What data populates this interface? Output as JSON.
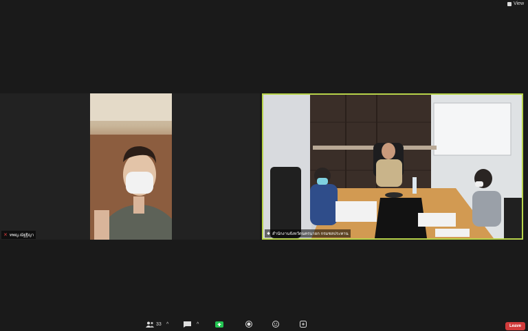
{
  "header": {
    "view_label": "View"
  },
  "participants": [
    {
      "name": "ทพญ.ณัฐฐิญา"
    },
    {
      "name": "สำนักงานจังหวัดนครนายก กรมชลประทาน"
    }
  ],
  "toolbar": {
    "participants_count": "33",
    "leave_label": "Leave"
  },
  "colors": {
    "active_speaker_border": "#b8d44a",
    "leave_button": "#d13b3b",
    "mic_off": "#e03c3c"
  }
}
